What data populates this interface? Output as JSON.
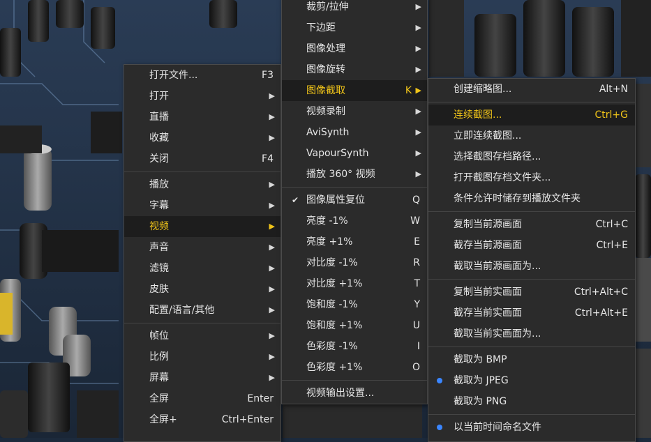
{
  "main_menu": {
    "items": [
      {
        "label": "打开文件...",
        "shortcut": "F3",
        "submenu": false
      },
      {
        "label": "打开",
        "shortcut": "",
        "submenu": true
      },
      {
        "label": "直播",
        "shortcut": "",
        "submenu": true
      },
      {
        "label": "收藏",
        "shortcut": "",
        "submenu": true
      },
      {
        "label": "关闭",
        "shortcut": "F4",
        "submenu": false
      },
      {
        "label": "播放",
        "shortcut": "",
        "submenu": true
      },
      {
        "label": "字幕",
        "shortcut": "",
        "submenu": true
      },
      {
        "label": "视频",
        "shortcut": "",
        "submenu": true,
        "highlighted": true
      },
      {
        "label": "声音",
        "shortcut": "",
        "submenu": true
      },
      {
        "label": "滤镜",
        "shortcut": "",
        "submenu": true
      },
      {
        "label": "皮肤",
        "shortcut": "",
        "submenu": true
      },
      {
        "label": "配置/语言/其他",
        "shortcut": "",
        "submenu": true
      },
      {
        "label": "帧位",
        "shortcut": "",
        "submenu": true
      },
      {
        "label": "比例",
        "shortcut": "",
        "submenu": true
      },
      {
        "label": "屏幕",
        "shortcut": "",
        "submenu": true
      },
      {
        "label": "全屏",
        "shortcut": "Enter",
        "submenu": false
      },
      {
        "label": "全屏+",
        "shortcut": "Ctrl+Enter",
        "submenu": false
      }
    ]
  },
  "video_menu": {
    "items": [
      {
        "label": "裁剪/拉伸",
        "shortcut": "",
        "submenu": true
      },
      {
        "label": "下边距",
        "shortcut": "",
        "submenu": true
      },
      {
        "label": "图像处理",
        "shortcut": "",
        "submenu": true
      },
      {
        "label": "图像旋转",
        "shortcut": "",
        "submenu": true
      },
      {
        "label": "图像截取",
        "shortcut": "K",
        "submenu": true,
        "highlighted": true
      },
      {
        "label": "视频录制",
        "shortcut": "",
        "submenu": true
      },
      {
        "label": "AviSynth",
        "shortcut": "",
        "submenu": true
      },
      {
        "label": "VapourSynth",
        "shortcut": "",
        "submenu": true
      },
      {
        "label": "播放 360° 视频",
        "shortcut": "",
        "submenu": true
      },
      {
        "label": "图像属性复位",
        "shortcut": "Q",
        "checked": true
      },
      {
        "label": "亮度 -1%",
        "shortcut": "W"
      },
      {
        "label": "亮度 +1%",
        "shortcut": "E"
      },
      {
        "label": "对比度 -1%",
        "shortcut": "R"
      },
      {
        "label": "对比度 +1%",
        "shortcut": "T"
      },
      {
        "label": "饱和度 -1%",
        "shortcut": "Y"
      },
      {
        "label": "饱和度 +1%",
        "shortcut": "U"
      },
      {
        "label": "色彩度 -1%",
        "shortcut": "I"
      },
      {
        "label": "色彩度 +1%",
        "shortcut": "O"
      },
      {
        "label": "视频输出设置...",
        "shortcut": ""
      }
    ]
  },
  "capture_menu": {
    "items": [
      {
        "label": "创建缩略图...",
        "shortcut": "Alt+N"
      },
      {
        "label": "连续截图...",
        "shortcut": "Ctrl+G",
        "highlighted": true
      },
      {
        "label": "立即连续截图...",
        "shortcut": ""
      },
      {
        "label": "选择截图存档路径...",
        "shortcut": ""
      },
      {
        "label": "打开截图存档文件夹...",
        "shortcut": ""
      },
      {
        "label": "条件允许时储存到播放文件夹",
        "shortcut": ""
      },
      {
        "label": "复制当前源画面",
        "shortcut": "Ctrl+C"
      },
      {
        "label": "截存当前源画面",
        "shortcut": "Ctrl+E"
      },
      {
        "label": "截取当前源画面为...",
        "shortcut": ""
      },
      {
        "label": "复制当前实画面",
        "shortcut": "Ctrl+Alt+C"
      },
      {
        "label": "截存当前实画面",
        "shortcut": "Ctrl+Alt+E"
      },
      {
        "label": "截取当前实画面为...",
        "shortcut": ""
      },
      {
        "label": "截取为 BMP",
        "shortcut": ""
      },
      {
        "label": "截取为 JPEG",
        "shortcut": "",
        "selected": true
      },
      {
        "label": "截取为 PNG",
        "shortcut": ""
      },
      {
        "label": "以当前时间命名文件",
        "shortcut": "",
        "selected": true
      }
    ]
  },
  "colors": {
    "menu_bg": "#2b2b2b",
    "highlight_text": "#f0c419",
    "radio_dot": "#3a86ff"
  }
}
